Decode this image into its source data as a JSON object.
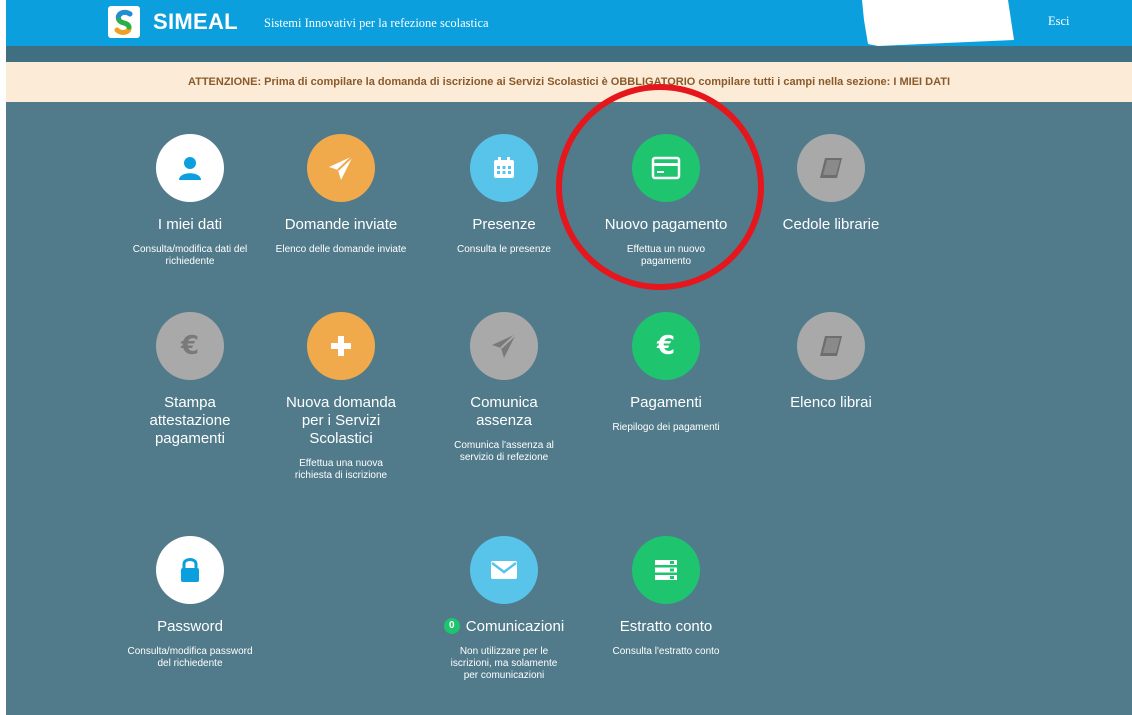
{
  "header": {
    "brand": "SIMEAL",
    "tagline": "Sistemi Innovativi per la refezione scolastica",
    "logout_label": "Esci"
  },
  "notice": {
    "text": "ATTENZIONE: Prima di compilare la domanda di iscrizione ai Servizi Scolastici è OBBLIGATORIO compilare tutti i campi nella sezione: I MIEI DATI"
  },
  "tiles": [
    {
      "key": "miei-dati",
      "icon": "user-icon",
      "color": "#ffffff",
      "title": "I miei dati",
      "desc": "Consulta/modifica dati del richiedente"
    },
    {
      "key": "domande-inviate",
      "icon": "paper-plane-icon",
      "color": "#f0aa4b",
      "title": "Domande inviate",
      "desc": "Elenco delle domande inviate"
    },
    {
      "key": "presenze",
      "icon": "calendar-icon",
      "color": "#58c4ea",
      "title": "Presenze",
      "desc": "Consulta le presenze"
    },
    {
      "key": "nuovo-pagamento",
      "icon": "credit-card-icon",
      "color": "#1ec46e",
      "title": "Nuovo pagamento",
      "desc": "Effettua un nuovo pagamento"
    },
    {
      "key": "cedole-librarie",
      "icon": "book-icon",
      "color": "#a9a9a9",
      "title": "Cedole librarie",
      "desc": ""
    },
    {
      "key": "stampa-attestazione",
      "icon": "euro-icon",
      "color": "#a9a9a9",
      "title": "Stampa attestazione pagamenti",
      "desc": ""
    },
    {
      "key": "nuova-domanda",
      "icon": "plus-icon",
      "color": "#f0aa4b",
      "title": "Nuova domanda per i Servizi Scolastici",
      "desc": "Effettua una nuova richiesta di iscrizione"
    },
    {
      "key": "comunica-assenza",
      "icon": "paper-plane-icon",
      "color": "#a9a9a9",
      "title": "Comunica assenza",
      "desc": "Comunica l'assenza al servizio di refezione"
    },
    {
      "key": "pagamenti",
      "icon": "euro-icon",
      "color": "#1ec46e",
      "title": "Pagamenti",
      "desc": "Riepilogo dei pagamenti"
    },
    {
      "key": "elenco-librai",
      "icon": "book-icon",
      "color": "#a9a9a9",
      "title": "Elenco librai",
      "desc": ""
    },
    {
      "key": "password",
      "icon": "lock-icon",
      "color": "#ffffff",
      "title": "Password",
      "desc": "Consulta/modifica password del richiedente"
    },
    {
      "key": "comunicazioni",
      "icon": "envelope-icon",
      "color": "#58c4ea",
      "title": "Comunicazioni",
      "badge": "0",
      "desc": "Non utilizzare per le iscrizioni, ma solamente per comunicazioni"
    },
    {
      "key": "estratto-conto",
      "icon": "list-icon",
      "color": "#1ec46e",
      "title": "Estratto conto",
      "desc": "Consulta l'estratto conto"
    }
  ],
  "highlight": {
    "target": "Nuovo pagamento",
    "color": "#e5161c"
  }
}
